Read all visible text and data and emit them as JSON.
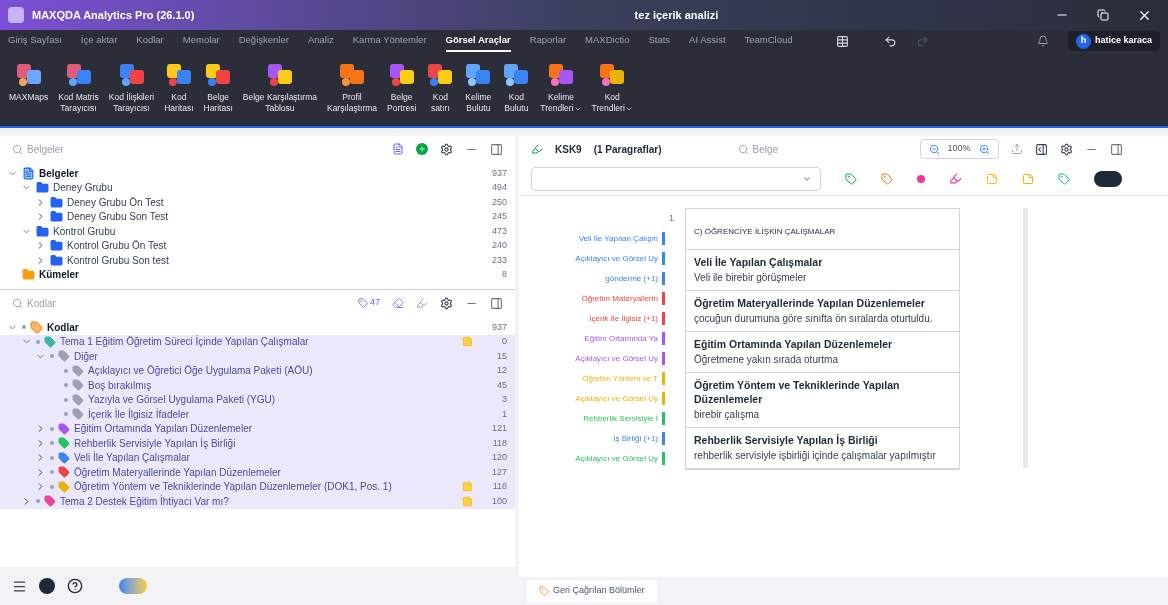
{
  "window": {
    "app_title": "MAXQDA Analytics Pro (26.1.0)",
    "project_title": "tez içerik analizi"
  },
  "menu_tabs": [
    {
      "label": "Giriş Sayfası",
      "selected": false
    },
    {
      "label": "İçe aktar",
      "selected": false
    },
    {
      "label": "Kodlar",
      "selected": false
    },
    {
      "label": "Memolar",
      "selected": false
    },
    {
      "label": "Değişkenler",
      "selected": false
    },
    {
      "label": "Analiz",
      "selected": false
    },
    {
      "label": "Karma Yöntemler",
      "selected": false
    },
    {
      "label": "Görsel Araçlar",
      "selected": true
    },
    {
      "label": "Raporlar",
      "selected": false
    },
    {
      "label": "MAXDictio",
      "selected": false
    },
    {
      "label": "Stats",
      "selected": false
    },
    {
      "label": "AI Assist",
      "selected": false
    },
    {
      "label": "TeamCloud",
      "selected": false
    }
  ],
  "user": {
    "initial": "h",
    "name": "hatice karaca"
  },
  "ribbon": [
    {
      "line1": "MAXMaps",
      "has_menu": false
    },
    {
      "line1": "Kod Matris",
      "line2": "Tarayıcısı",
      "has_menu": false
    },
    {
      "line1": "Kod İlişkileri",
      "line2": "Tarayıcısı",
      "has_menu": false
    },
    {
      "line1": "Kod",
      "line2": "Haritası",
      "has_menu": false
    },
    {
      "line1": "Belge",
      "line2": "Haritası",
      "has_menu": false
    },
    {
      "line1": "Belge Karşılaştırma",
      "line2": "Tablosu",
      "has_menu": false
    },
    {
      "line1": "Profil",
      "line2": "Karşılaştırma",
      "has_menu": false
    },
    {
      "line1": "Belge",
      "line2": "Portresi",
      "has_menu": false
    },
    {
      "line1": "Kod",
      "line2": "satırı",
      "has_menu": false
    },
    {
      "line1": "Kelime",
      "line2": "Bulutu",
      "has_menu": false
    },
    {
      "line1": "Kod",
      "line2": "Bulutu",
      "has_menu": false
    },
    {
      "line1": "Kelime",
      "line2": "Trendleri",
      "has_menu": true
    },
    {
      "line1": "Kod",
      "line2": "Trendleri",
      "has_menu": true
    }
  ],
  "documents": {
    "search_placeholder": "Belgeler",
    "items": [
      {
        "kind": "root",
        "label": "Belgeler",
        "count": "937",
        "expanded": true,
        "children": [
          {
            "kind": "group",
            "label": "Deney Grubu",
            "count": "494",
            "expanded": true,
            "children": [
              {
                "kind": "group",
                "label": "Deney Grubu Ön Test",
                "count": "250",
                "expanded": false
              },
              {
                "kind": "group",
                "label": "Deney Grubu Son Test",
                "count": "245",
                "expanded": false
              }
            ]
          },
          {
            "kind": "group",
            "label": "Kontrol Grubu",
            "count": "473",
            "expanded": true,
            "children": [
              {
                "kind": "group",
                "label": "Kontrol Grubu Ön Test",
                "count": "240",
                "expanded": false
              },
              {
                "kind": "group",
                "label": "Kontrol Grubu Son test",
                "count": "233",
                "expanded": false
              }
            ]
          }
        ]
      },
      {
        "kind": "sets",
        "label": "Kümeler",
        "count": "8"
      }
    ]
  },
  "codes": {
    "search_placeholder": "Kodlar",
    "activated_count": "47",
    "items": [
      {
        "kind": "root",
        "label": "Kodlar",
        "count": "937",
        "expanded": true,
        "children": [
          {
            "kind": "code",
            "label": "Tema 1 Eğitim Öğretim Süreci İçinde Yapılan Çalışmalar",
            "count": "0",
            "color": "#3bb8a8",
            "memo": true,
            "expanded": true,
            "children": [
              {
                "kind": "code",
                "label": "Diğer",
                "count": "15",
                "color": "#9ca3af",
                "memo": false,
                "expanded": true,
                "children": [
                  {
                    "kind": "code",
                    "label": "Açıklayıcı ve Öğretici Öğe Uygulama Paketi (AÖU)",
                    "count": "12",
                    "color": "#9ca3af",
                    "memo": false
                  },
                  {
                    "kind": "code",
                    "label": "Boş bırakılmış",
                    "count": "45",
                    "color": "#9ca3af",
                    "memo": false
                  },
                  {
                    "kind": "code",
                    "label": "Yazıyla ve Görsel Uygulama Paketi (YGU)",
                    "count": "3",
                    "color": "#9ca3af",
                    "memo": false
                  },
                  {
                    "kind": "code",
                    "label": "İçerik İle İlgisiz İfadeler",
                    "count": "1",
                    "color": "#9ca3af",
                    "memo": false
                  }
                ]
              },
              {
                "kind": "code",
                "label": "Eğitim Ortamında Yapılan Düzenlemeler",
                "count": "121",
                "color": "#a855f7",
                "memo": false,
                "expanded": false
              },
              {
                "kind": "code",
                "label": "Rehberlik Servisiyle Yapılan İş Birliği",
                "count": "118",
                "color": "#22c55e",
                "memo": false,
                "expanded": false
              },
              {
                "kind": "code",
                "label": "Veli İle Yapılan Çalışmalar",
                "count": "120",
                "color": "#3b82f6",
                "memo": false,
                "expanded": false
              },
              {
                "kind": "code",
                "label": "Öğretim Materyallerinde Yapılan Düzenlemeler",
                "count": "127",
                "color": "#ef4444",
                "memo": false,
                "expanded": false
              },
              {
                "kind": "code",
                "label": "Öğretim Yöntem ve Tekniklerinde Yapılan Düzenlemeler  (DOK1, Pos. 1)",
                "count": "118",
                "color": "#eab308",
                "memo": true,
                "expanded": false
              }
            ]
          },
          {
            "kind": "code",
            "label": "Tema 2 Destek Eğitim İhtiyacı Var mı?",
            "count": "100",
            "color": "#ec4899",
            "memo": true,
            "expanded": false
          }
        ]
      }
    ]
  },
  "document_browser": {
    "title": "KSK9",
    "subtitle": "(1 Paragraflar)",
    "search_placeholder": "Belge",
    "zoom": "100%",
    "paragraph_number": "1",
    "stripes": [
      {
        "label": "Veli İle Yapılan Çalışm",
        "color": "#3b82f6"
      },
      {
        "label": "Açıklayıcı ve Görsel Uy",
        "color": "#3b82f6"
      },
      {
        "label": "gönderme (+1)",
        "color": "#3b82f6"
      },
      {
        "label": "Öğretim Materyallerin",
        "color": "#ef4444"
      },
      {
        "label": "İçerik İle İlgisiz (+1)",
        "color": "#ef4444"
      },
      {
        "label": "Eğitim Ortamında Ya",
        "color": "#a855f7"
      },
      {
        "label": "Açıklayıcı ve Görsel Uy",
        "color": "#a855f7"
      },
      {
        "label": "Öğretim Yöntem ve T",
        "color": "#eab308"
      },
      {
        "label": "Açıklayıcı ve Görsel Uy",
        "color": "#eab308"
      },
      {
        "label": "Rehberlik Servisiyle İ",
        "color": "#22c55e"
      },
      {
        "label": "İş Birliği (+1)",
        "color": "#3b82f6"
      },
      {
        "label": "Açıklayıcı ve Görsel Uy",
        "color": "#22c55e"
      }
    ],
    "rows": [
      {
        "kind": "heading",
        "title": "C) ÖĞRENCİYE İLİŞKİN ÇALIŞMALAR"
      },
      {
        "kind": "section",
        "title": "Veli İle Yapılan Çalışmalar",
        "text": "Veli ile birebir görüşmeler"
      },
      {
        "kind": "section",
        "title": "Öğretim Materyallerinde Yapılan Düzenlemeler",
        "text": "çocuğun durumuna göre sınıfta ön sıralarda oturtuldu."
      },
      {
        "kind": "section",
        "title": "Eğitim Ortamında Yapılan Düzenlemeler",
        "text": "Öğretmene yakın sırada oturtma"
      },
      {
        "kind": "section",
        "title": "Öğretim Yöntem ve Tekniklerinde Yapılan Düzenlemeler",
        "text": "birebir çalışma"
      },
      {
        "kind": "section",
        "title": "Rehberlik Servisiyle Yapılan İş Birliği",
        "text": "rehberlik servisiyle işbirliği içinde çalışmalar yapılmıştır"
      }
    ]
  },
  "bottom_tab": {
    "label": "Geri Çağrılan Bölümler"
  }
}
